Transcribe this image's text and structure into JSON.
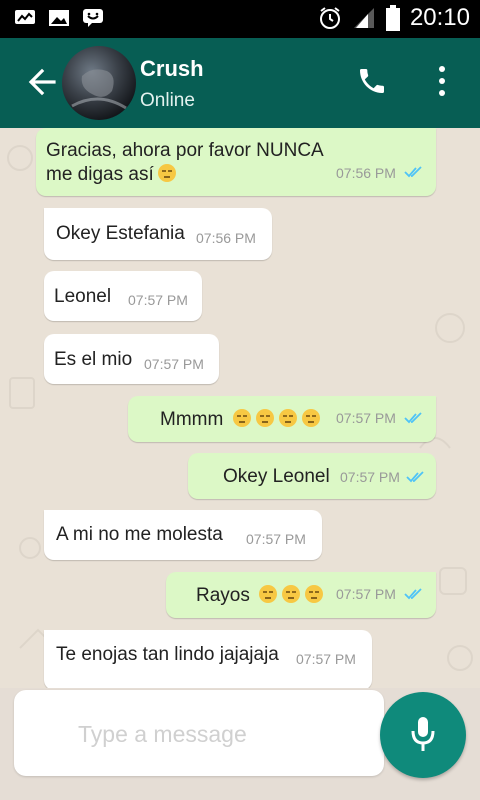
{
  "status_bar": {
    "time": "20:10",
    "icons": [
      "message-notification-icon",
      "image-notification-icon",
      "chat-notification-icon",
      "alarm-icon",
      "signal-icon",
      "battery-icon"
    ]
  },
  "header": {
    "contact_name": "Crush",
    "contact_status": "Online",
    "icons": [
      "back-arrow-icon",
      "phone-icon",
      "more-vert-icon"
    ]
  },
  "messages": [
    {
      "dir": "out",
      "line1": "Gracias, ahora por favor NUNCA",
      "line2": "me digas así",
      "time": "07:56 PM",
      "emoji": [
        "unamused-face"
      ],
      "status": "read"
    },
    {
      "dir": "in",
      "text": "Okey Estefania",
      "time": "07:56 PM"
    },
    {
      "dir": "in",
      "text": "Leonel",
      "time": "07:57 PM"
    },
    {
      "dir": "in",
      "text": "Es el mio",
      "time": "07:57 PM"
    },
    {
      "dir": "out",
      "text": "Mmmm",
      "time": "07:57 PM",
      "emoji": [
        "unamused-face",
        "unamused-face",
        "unamused-face",
        "unamused-face"
      ],
      "status": "read"
    },
    {
      "dir": "out",
      "text": "Okey Leonel",
      "time": "07:57 PM",
      "status": "read"
    },
    {
      "dir": "in",
      "text": "A mi no me molesta",
      "time": "07:57 PM"
    },
    {
      "dir": "out",
      "text": "Rayos",
      "time": "07:57 PM",
      "emoji": [
        "unamused-face",
        "unamused-face",
        "unamused-face"
      ],
      "status": "read"
    },
    {
      "dir": "in",
      "text": "Te enojas tan lindo jajajaja",
      "time": "07:57 PM"
    }
  ],
  "composer": {
    "placeholder": "Type a message",
    "value": ""
  },
  "colors": {
    "header": "#075e54",
    "outgoing_bubble": "#dcf8c6",
    "incoming_bubble": "#ffffff",
    "read_ticks": "#4fc3f7",
    "mic_button": "#0f8a7b"
  }
}
